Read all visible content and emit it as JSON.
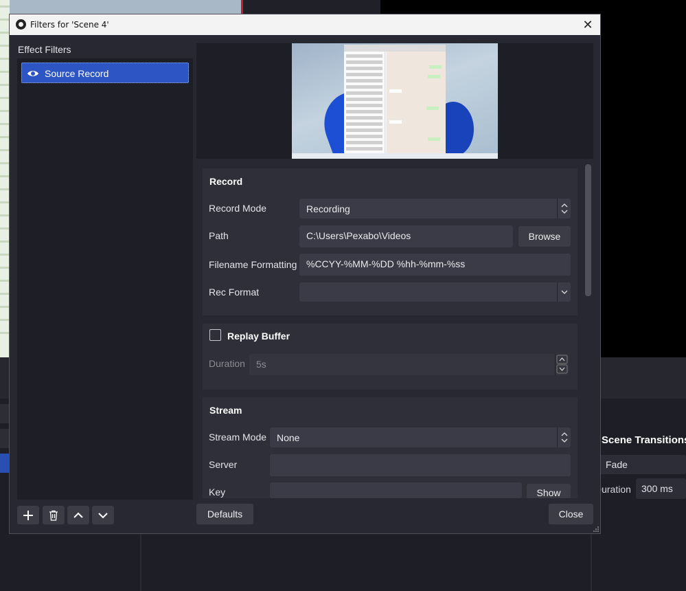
{
  "dialog": {
    "title": "Filters for 'Scene 4'",
    "effect_filters_label": "Effect Filters",
    "filters": [
      {
        "name": "Source Record",
        "icon": "eye-icon"
      }
    ],
    "defaults_label": "Defaults",
    "close_label": "Close"
  },
  "record": {
    "title": "Record",
    "record_mode_label": "Record Mode",
    "record_mode_value": "Recording",
    "path_label": "Path",
    "path_value": "C:\\Users\\Pexabo\\Videos",
    "browse_label": "Browse",
    "filename_label": "Filename Formatting",
    "filename_value": "%CCYY-%MM-%DD %hh-%mm-%ss",
    "rec_format_label": "Rec Format",
    "rec_format_value": ""
  },
  "replay": {
    "title": "Replay Buffer",
    "checked": false,
    "duration_label": "Duration",
    "duration_value": "5s"
  },
  "stream": {
    "title": "Stream",
    "stream_mode_label": "Stream Mode",
    "stream_mode_value": "None",
    "server_label": "Server",
    "server_value": "",
    "key_label": "Key",
    "key_value": "",
    "show_label": "Show"
  },
  "background": {
    "scene_transitions_title": "Scene Transitions",
    "transition_value": "Fade",
    "duration_label": "Duration",
    "duration_value": "300 ms"
  },
  "colors": {
    "accent": "#2d55c4",
    "dialog_bg": "#272831",
    "titlebar_bg": "#f3f3f3"
  }
}
